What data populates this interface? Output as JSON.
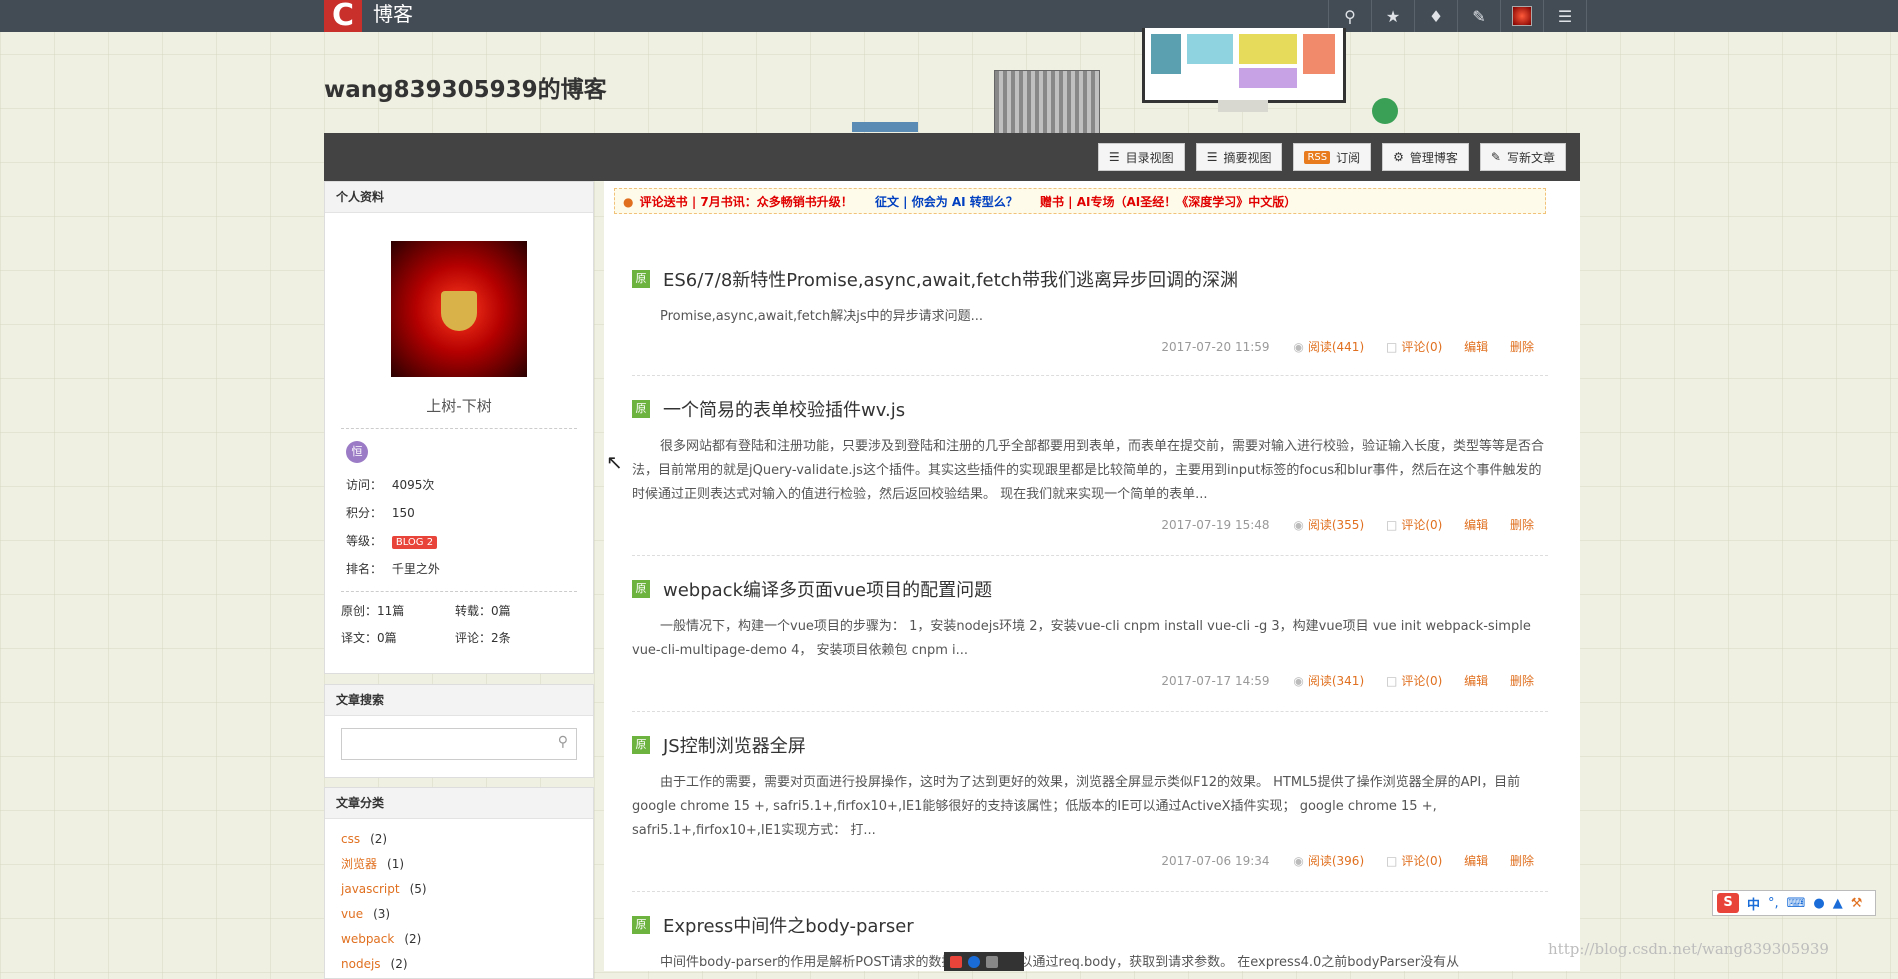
{
  "topbar": {
    "logo_letter": "C",
    "brand": "博客",
    "icons": [
      "search-icon",
      "star-icon",
      "bell-icon",
      "edit-icon",
      "avatar",
      "menu-icon"
    ]
  },
  "blog": {
    "title": "wang839305939的博客"
  },
  "toolbar": {
    "buttons": [
      {
        "icon": "list-icon",
        "label": "目录视图"
      },
      {
        "icon": "summary-icon",
        "label": "摘要视图"
      },
      {
        "icon": "rss-icon",
        "badge": "RSS",
        "label": "订阅"
      },
      {
        "icon": "gear-icon",
        "label": "管理博客"
      },
      {
        "icon": "write-icon",
        "label": "写新文章"
      }
    ]
  },
  "sidebar": {
    "profile": {
      "header": "个人资料",
      "name": "上树-下树",
      "medal": "恒",
      "stats": [
        {
          "label": "访问：",
          "value": "4095次"
        },
        {
          "label": "积分：",
          "value": "150"
        },
        {
          "label": "等级：",
          "value": "BLOG 2"
        },
        {
          "label": "排名：",
          "value": "千里之外"
        }
      ],
      "counts": [
        {
          "label": "原创：",
          "value": "11篇"
        },
        {
          "label": "转载：",
          "value": "0篇"
        },
        {
          "label": "译文：",
          "value": "0篇"
        },
        {
          "label": "评论：",
          "value": "2条"
        }
      ]
    },
    "search": {
      "header": "文章搜索",
      "placeholder": ""
    },
    "categories": {
      "header": "文章分类",
      "items": [
        {
          "name": "css",
          "count": "(2)"
        },
        {
          "name": "浏览器",
          "count": "(1)"
        },
        {
          "name": "javascript",
          "count": "(5)"
        },
        {
          "name": "vue",
          "count": "(3)"
        },
        {
          "name": "webpack",
          "count": "(2)"
        },
        {
          "name": "nodejs",
          "count": "(2)"
        }
      ]
    }
  },
  "notice": {
    "items": [
      "评论送书 | 7月书讯：众多畅销书升级！",
      "征文 | 你会为 AI 转型么？",
      "赠书 | AI专场（AI圣经！《深度学习》中文版）"
    ]
  },
  "articles": [
    {
      "tag": "原",
      "title": "ES6/7/8新特性Promise,async,await,fetch带我们逃离异步回调的深渊",
      "desc": "Promise,async,await,fetch解决js中的异步请求问题...",
      "date": "2017-07-20 11:59",
      "read": "阅读(441)",
      "comment": "评论(0)",
      "edit": "编辑",
      "delete": "删除"
    },
    {
      "tag": "原",
      "title": "一个简易的表单校验插件wv.js",
      "desc": "很多网站都有登陆和注册功能，只要涉及到登陆和注册的几乎全部都要用到表单，而表单在提交前，需要对输入进行校验，验证输入长度，类型等等是否合法，目前常用的就是jQuery-validate.js这个插件。其实这些插件的实现跟里都是比较简单的，主要用到input标签的focus和blur事件，然后在这个事件触发的时候通过正则表达式对输入的值进行检验，然后返回校验结果。 现在我们就来实现一个简单的表单...",
      "date": "2017-07-19 15:48",
      "read": "阅读(355)",
      "comment": "评论(0)",
      "edit": "编辑",
      "delete": "删除"
    },
    {
      "tag": "原",
      "title": "webpack编译多页面vue项目的配置问题",
      "desc": "一般情况下，构建一个vue项目的步骤为： 1，安装nodejs环境 2，安装vue-cli cnpm install vue-cli -g 3，构建vue项目 vue init webpack-simple vue-cli-multipage-demo 4， 安装项目依赖包 cnpm i...",
      "date": "2017-07-17 14:59",
      "read": "阅读(341)",
      "comment": "评论(0)",
      "edit": "编辑",
      "delete": "删除"
    },
    {
      "tag": "原",
      "title": "JS控制浏览器全屏",
      "desc": "由于工作的需要，需要对页面进行投屏操作，这时为了达到更好的效果，浏览器全屏显示类似F12的效果。 HTML5提供了操作浏览器全屏的API，目前google chrome 15 +, safri5.1+,firfox10+,IE1能够很好的支持该属性；低版本的IE可以通过ActiveX插件实现； google chrome 15 +, safri5.1+,firfox10+,IE1实现方式： 打...",
      "date": "2017-07-06 19:34",
      "read": "阅读(396)",
      "comment": "评论(0)",
      "edit": "编辑",
      "delete": "删除"
    },
    {
      "tag": "原",
      "title": "Express中间件之body-parser",
      "desc": "中间件body-parser的作用是解析POST请求的数据，后我们可以通过req.body，获取到请求参数。 在express4.0之前bodyParser没有从",
      "date": "",
      "read": "",
      "comment": "",
      "edit": "",
      "delete": ""
    }
  ],
  "ime": {
    "logo": "S",
    "mode": "中"
  },
  "watermark": "http://blog.csdn.net/wang839305939"
}
